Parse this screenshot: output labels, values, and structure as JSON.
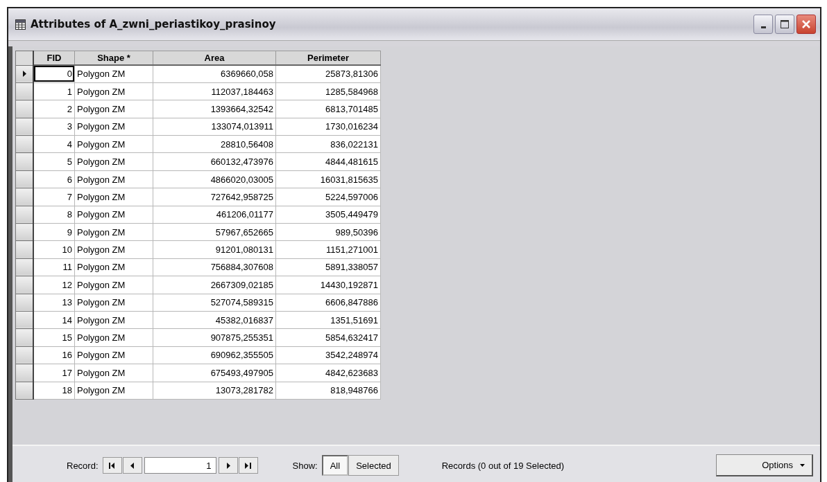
{
  "window": {
    "title": "Attributes of A_zwni_periastikoy_prasinoy"
  },
  "table": {
    "columns": [
      "FID",
      "Shape *",
      "Area",
      "Perimeter"
    ],
    "rows": [
      {
        "cells": [
          "0",
          "Polygon ZM",
          "6369660,058",
          "25873,81306"
        ],
        "current": true
      },
      {
        "cells": [
          "1",
          "Polygon ZM",
          "112037,184463",
          "1285,584968"
        ],
        "current": false
      },
      {
        "cells": [
          "2",
          "Polygon ZM",
          "1393664,32542",
          "6813,701485"
        ],
        "current": false
      },
      {
        "cells": [
          "3",
          "Polygon ZM",
          "133074,013911",
          "1730,016234"
        ],
        "current": false
      },
      {
        "cells": [
          "4",
          "Polygon ZM",
          "28810,56408",
          "836,022131"
        ],
        "current": false
      },
      {
        "cells": [
          "5",
          "Polygon ZM",
          "660132,473976",
          "4844,481615"
        ],
        "current": false
      },
      {
        "cells": [
          "6",
          "Polygon ZM",
          "4866020,03005",
          "16031,815635"
        ],
        "current": false
      },
      {
        "cells": [
          "7",
          "Polygon ZM",
          "727642,958725",
          "5224,597006"
        ],
        "current": false
      },
      {
        "cells": [
          "8",
          "Polygon ZM",
          "461206,01177",
          "3505,449479"
        ],
        "current": false
      },
      {
        "cells": [
          "9",
          "Polygon ZM",
          "57967,652665",
          "989,50396"
        ],
        "current": false
      },
      {
        "cells": [
          "10",
          "Polygon ZM",
          "91201,080131",
          "1151,271001"
        ],
        "current": false
      },
      {
        "cells": [
          "11",
          "Polygon ZM",
          "756884,307608",
          "5891,338057"
        ],
        "current": false
      },
      {
        "cells": [
          "12",
          "Polygon ZM",
          "2667309,02185",
          "14430,192871"
        ],
        "current": false
      },
      {
        "cells": [
          "13",
          "Polygon ZM",
          "527074,589315",
          "6606,847886"
        ],
        "current": false
      },
      {
        "cells": [
          "14",
          "Polygon ZM",
          "45382,016837",
          "1351,51691"
        ],
        "current": false
      },
      {
        "cells": [
          "15",
          "Polygon ZM",
          "907875,255351",
          "5854,632417"
        ],
        "current": false
      },
      {
        "cells": [
          "16",
          "Polygon ZM",
          "690962,355505",
          "3542,248974"
        ],
        "current": false
      },
      {
        "cells": [
          "17",
          "Polygon ZM",
          "675493,497905",
          "4842,623683"
        ],
        "current": false
      },
      {
        "cells": [
          "18",
          "Polygon ZM",
          "13073,281782",
          "818,948766"
        ],
        "current": false
      }
    ]
  },
  "footer": {
    "record_label": "Record:",
    "record_value": "1",
    "show_label": "Show:",
    "show_options": [
      {
        "label": "All",
        "selected": true
      },
      {
        "label": "Selected",
        "selected": false
      }
    ],
    "status": "Records (0 out of 19 Selected)",
    "options_button": "Options"
  }
}
